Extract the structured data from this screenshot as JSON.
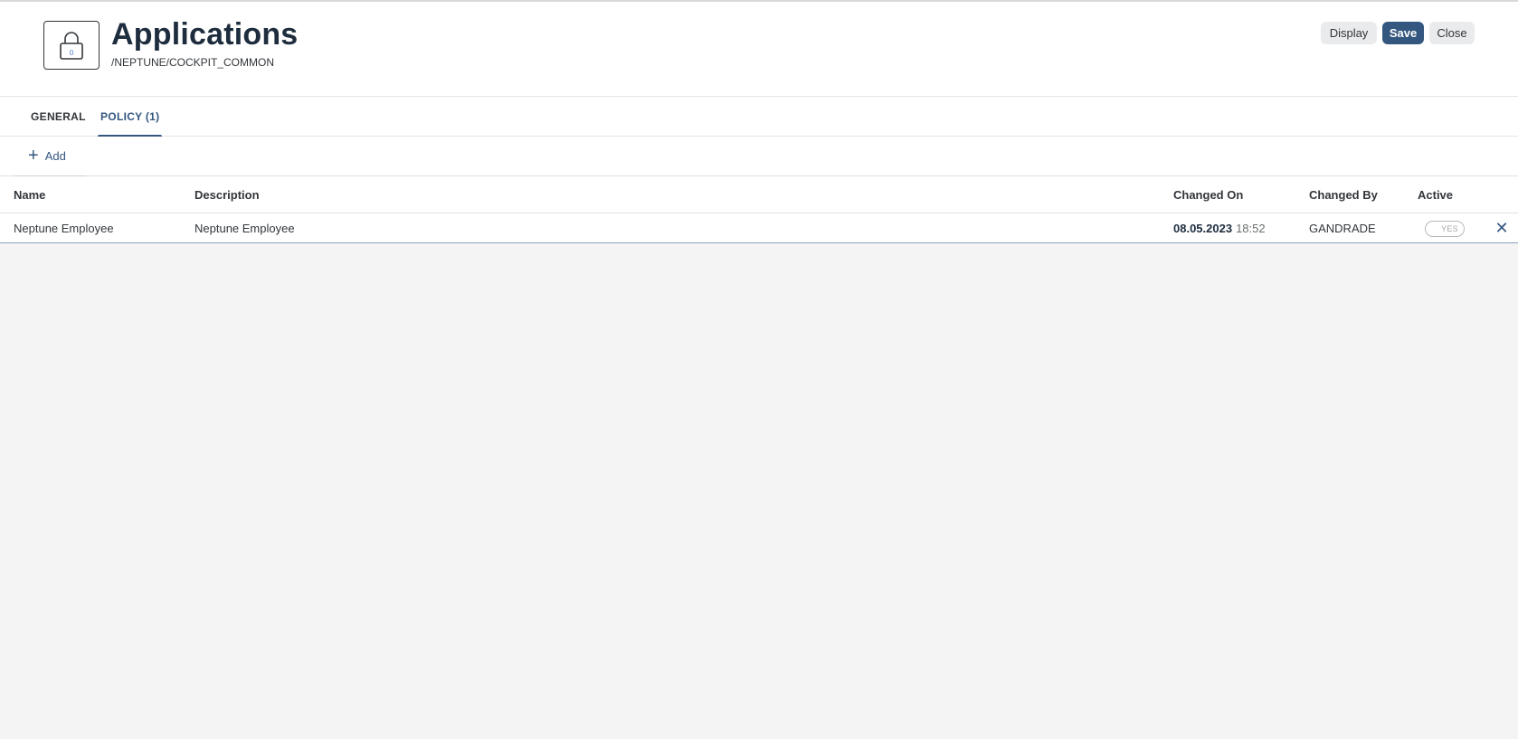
{
  "header": {
    "title": "Applications",
    "subtitle": "/NEPTUNE/COCKPIT_COMMON",
    "avatar_icon": "lock-icon",
    "buttons": {
      "display": "Display",
      "save": "Save",
      "close": "Close"
    }
  },
  "tabs": [
    {
      "label": "GENERAL",
      "selected": false
    },
    {
      "label": "POLICY (1)",
      "selected": true
    }
  ],
  "toolbar": {
    "add_label": "Add",
    "add_icon": "plus-icon"
  },
  "table": {
    "columns": [
      "Name",
      "Description",
      "Changed On",
      "Changed By",
      "Active"
    ],
    "rows": [
      {
        "name": "Neptune Employee",
        "description": "Neptune Employee",
        "changed_on_date": "08.05.2023",
        "changed_on_time": "18:52",
        "changed_by": "GANDRADE",
        "active": "YES",
        "delete_icon": "close-icon"
      }
    ]
  },
  "colors": {
    "accent": "#34577f",
    "title": "#1d2d3e",
    "background": "#f4f4f4"
  }
}
